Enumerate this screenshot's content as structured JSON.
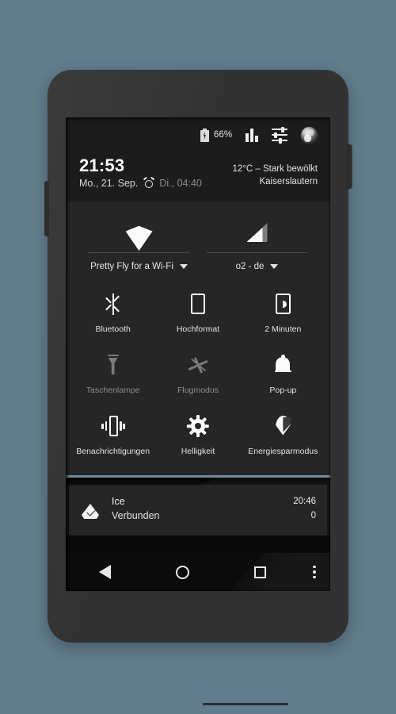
{
  "statusbar": {
    "battery_percent": "66%",
    "icons": [
      "battery-charging-icon",
      "bar-chart-icon",
      "sliders-icon",
      "user-avatar"
    ]
  },
  "header": {
    "time": "21:53",
    "date": "Mo., 21. Sep.",
    "alarm_next": "Di., 04:40",
    "weather_condition": "12°C – Stark bewölkt",
    "weather_location": "Kaiserslautern"
  },
  "quick_settings": {
    "connections": [
      {
        "icon": "wifi-icon",
        "label": "Pretty Fly for a Wi-Fi",
        "state": "on"
      },
      {
        "icon": "cellular-signal-icon",
        "label": "o2 - de",
        "state": "on"
      }
    ],
    "tiles": [
      {
        "icon": "bluetooth-icon",
        "label": "Bluetooth",
        "state": "on"
      },
      {
        "icon": "rotation-portrait-icon",
        "label": "Hochformat",
        "state": "on"
      },
      {
        "icon": "screen-timeout-icon",
        "label": "2 Minuten",
        "state": "on"
      },
      {
        "icon": "flashlight-icon",
        "label": "Taschenlampe",
        "state": "off"
      },
      {
        "icon": "airplane-mode-icon",
        "label": "Flugmodus",
        "state": "off"
      },
      {
        "icon": "notification-bell-icon",
        "label": "Pop-up",
        "state": "on"
      },
      {
        "icon": "vibrate-icon",
        "label": "Benachrichtigungen",
        "state": "on"
      },
      {
        "icon": "brightness-icon",
        "label": "Helligkeit",
        "state": "on"
      },
      {
        "icon": "battery-saver-pin-icon",
        "label": "Energiesparmodus",
        "state": "on"
      }
    ],
    "scroll_hint": "›"
  },
  "notifications": [
    {
      "icon": "shield-check-icon",
      "title": "Ice",
      "subtitle": "Verbunden",
      "time": "20:46",
      "count": "0"
    }
  ],
  "navbar": {
    "back": "back-button",
    "home": "home-button",
    "recents": "recents-button",
    "overflow": "overflow-menu-button"
  },
  "colors": {
    "background": "#627d8d",
    "phone_body": "#323232",
    "statusbar_bg": "#1c1c1c",
    "panel_bg": "#262626",
    "accent_divider": "#6f8b9b",
    "notification_bg": "#252525"
  }
}
